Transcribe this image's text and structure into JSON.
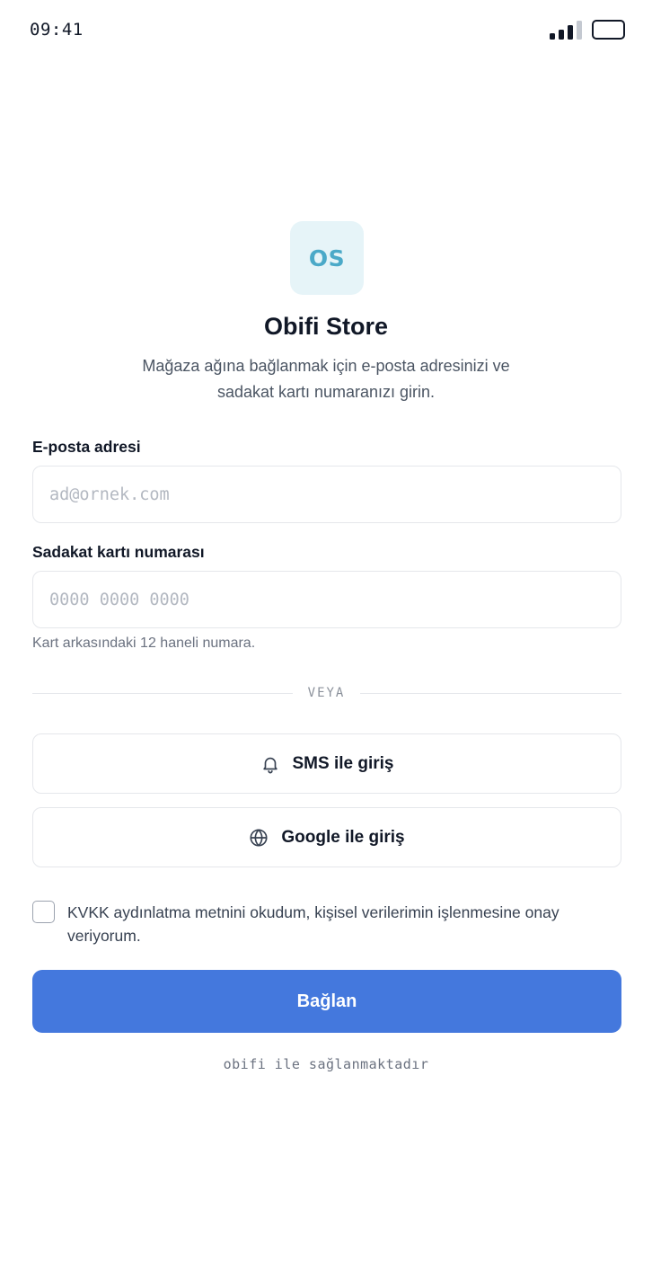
{
  "status_bar": {
    "time": "09:41",
    "signal_icon": "signal-bars-icon",
    "battery_icon": "battery-icon"
  },
  "store": {
    "logo_initials": "OS",
    "name": "Obifi Store",
    "description": "Mağaza ağına bağlanmak için e-posta adresinizi ve sadakat kartı numaranızı girin."
  },
  "form": {
    "email": {
      "label": "E-posta adresi",
      "placeholder": "ad@ornek.com",
      "value": ""
    },
    "card": {
      "label": "Sadakat kartı numarası",
      "placeholder": "0000 0000 0000",
      "value": "",
      "hint": "Kart arkasındaki 12 haneli numara."
    }
  },
  "divider_text": "VEYA",
  "alt_login": {
    "sms": {
      "label": "SMS ile giriş",
      "icon": "bell-icon"
    },
    "google": {
      "label": "Google ile giriş",
      "icon": "globe-icon"
    }
  },
  "consent": {
    "checked": false,
    "text": "KVKK aydınlatma metnini okudum, kişisel verilerimin işlenmesine onay veriyorum."
  },
  "submit_label": "Bağlan",
  "footer": "obifi ile sağlanmaktadır",
  "colors": {
    "primary": "#4478dd",
    "logo_bg": "#e6f4f8",
    "logo_text": "#4ba9c8",
    "text": "#111827",
    "muted": "#6b7280",
    "border": "#e5e7eb"
  }
}
